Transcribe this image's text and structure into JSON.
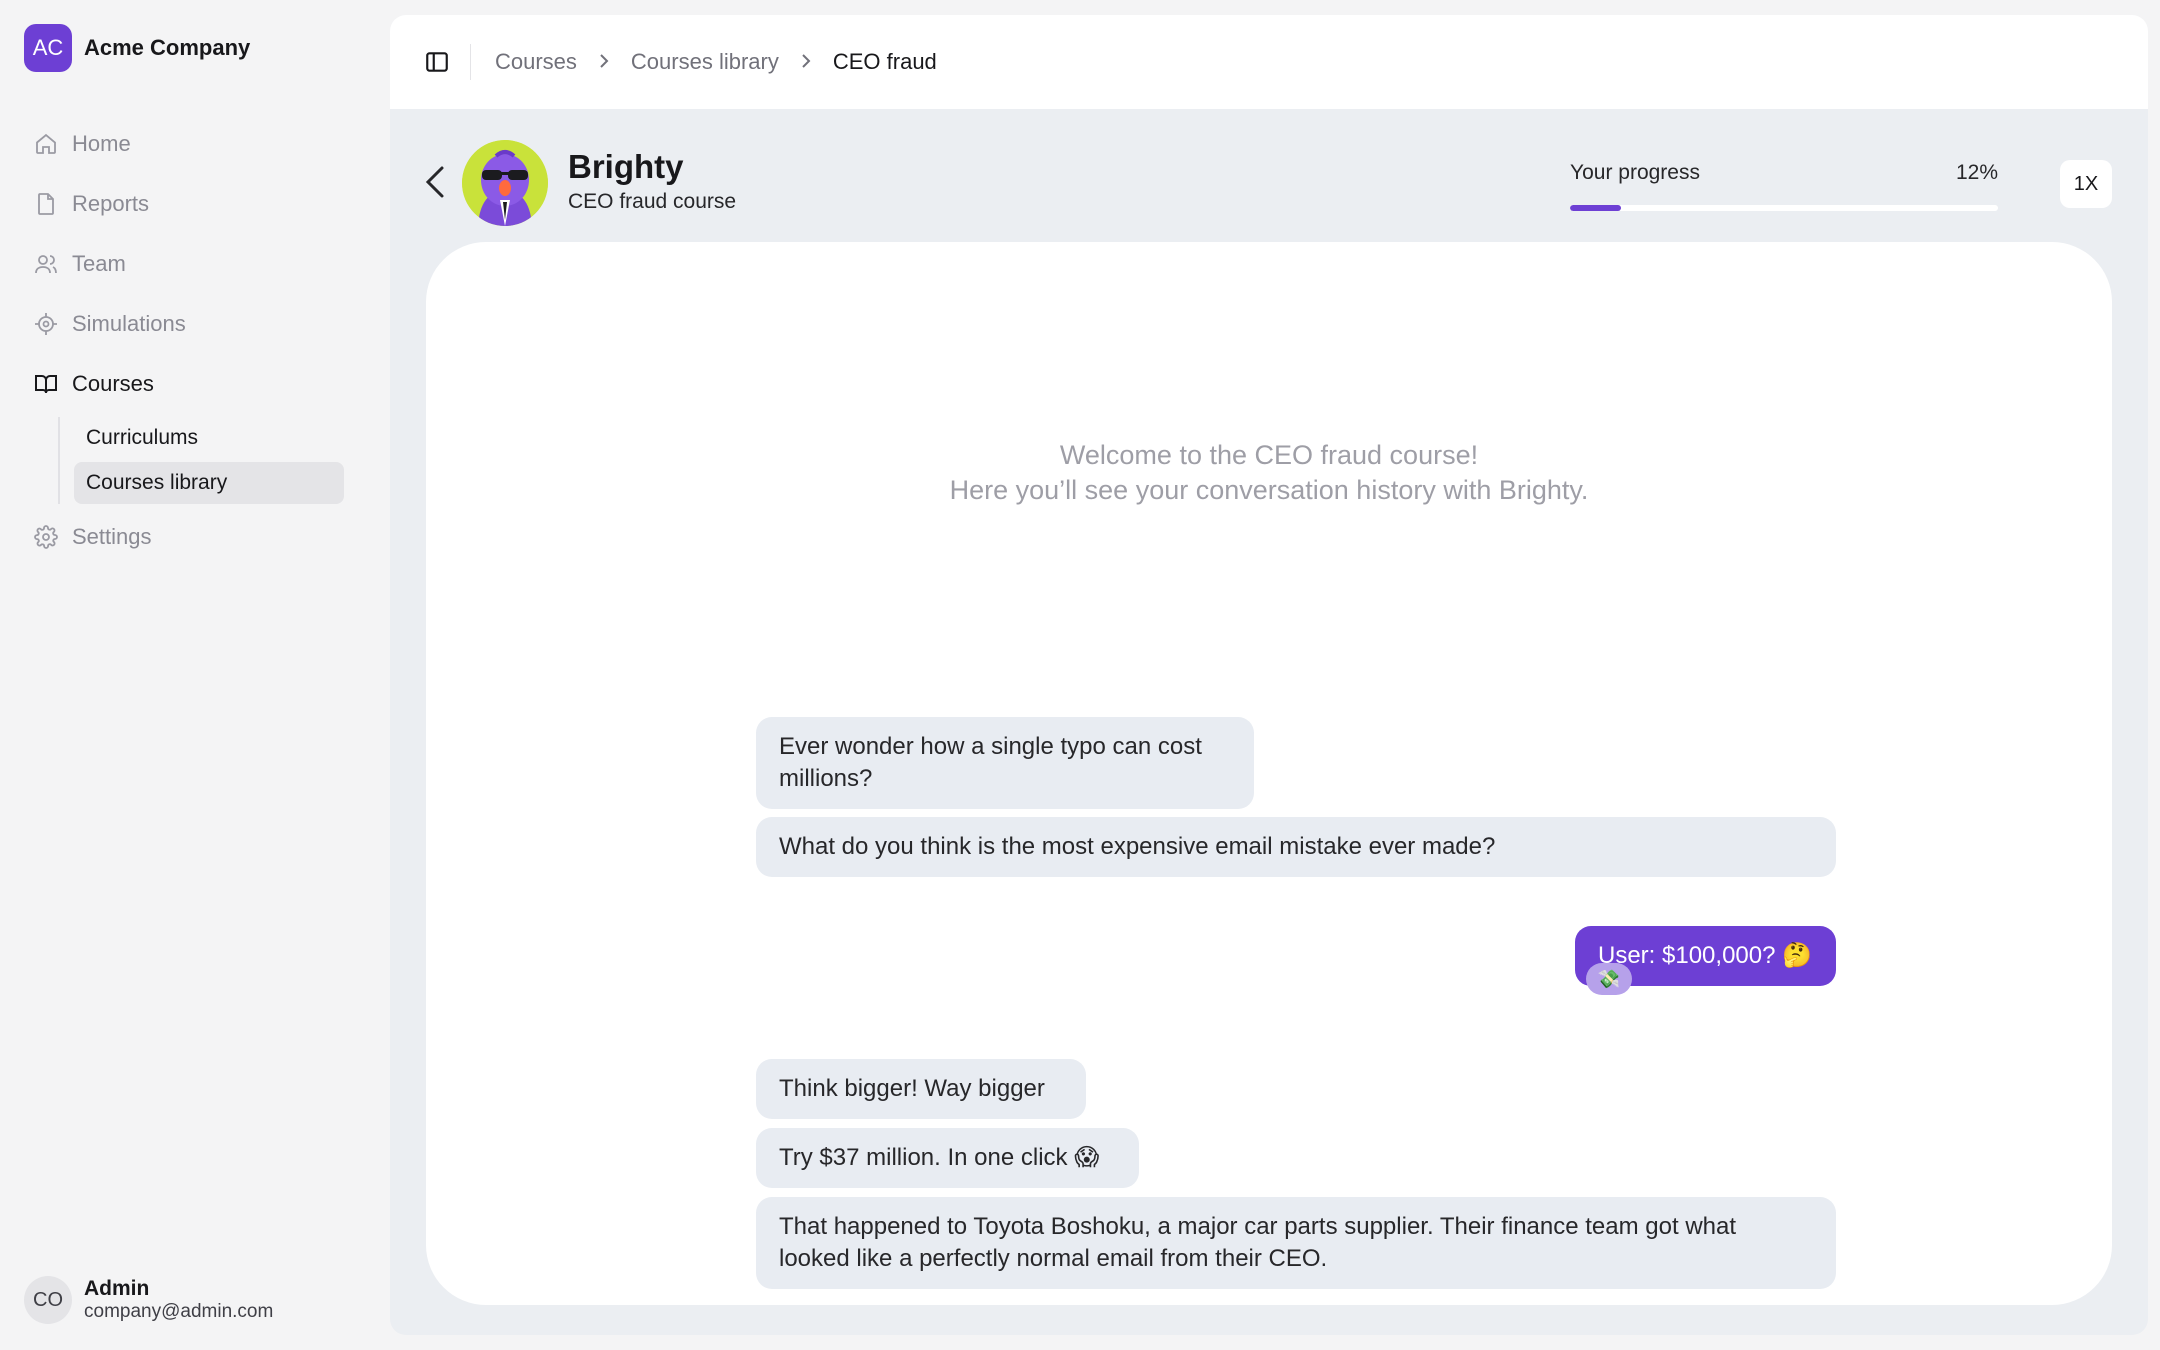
{
  "company": {
    "initials": "AC",
    "name": "Acme Company"
  },
  "nav": {
    "home": "Home",
    "reports": "Reports",
    "team": "Team",
    "simulations": "Simulations",
    "courses": "Courses",
    "curriculums": "Curriculums",
    "courses_library": "Courses library",
    "settings": "Settings"
  },
  "user": {
    "initials": "CO",
    "name": "Admin",
    "email": "company@admin.com"
  },
  "breadcrumb": {
    "item1": "Courses",
    "item2": "Courses library",
    "current": "CEO fraud"
  },
  "course": {
    "bot_name": "Brighty",
    "subtitle": "CEO fraud course"
  },
  "progress": {
    "label": "Your progress",
    "value_text": "12%",
    "value": 0.12
  },
  "speed": "1X",
  "chat": {
    "welcome_line1": "Welcome to the CEO fraud course!",
    "welcome_line2": "Here you’ll see your conversation history with Brighty.",
    "messages": [
      {
        "from": "bot",
        "text": "Ever wonder how a single typo can cost millions?"
      },
      {
        "from": "bot",
        "text": "What do you think is the most expensive email mistake ever made?"
      },
      {
        "from": "user",
        "text": "User: $100,000? 🤔",
        "reaction": "💸"
      },
      {
        "from": "bot",
        "text": "Think bigger! Way bigger"
      },
      {
        "from": "bot",
        "text": "Try $37 million. In one click 😱"
      },
      {
        "from": "bot",
        "text": "That happened to Toyota Boshoku, a major car parts supplier. Their finance team got what looked like a perfectly normal email from their CEO."
      }
    ]
  },
  "colors": {
    "accent": "#6d3fd4",
    "bubble_bot": "#e8ecf2",
    "avatar_bg": "#c9e23a"
  },
  "icons": [
    "home-icon",
    "file-icon",
    "users-icon",
    "target-icon",
    "book-open-icon",
    "gear-icon",
    "sidebar-toggle-icon",
    "chevron-right-icon",
    "chevron-left-icon"
  ]
}
